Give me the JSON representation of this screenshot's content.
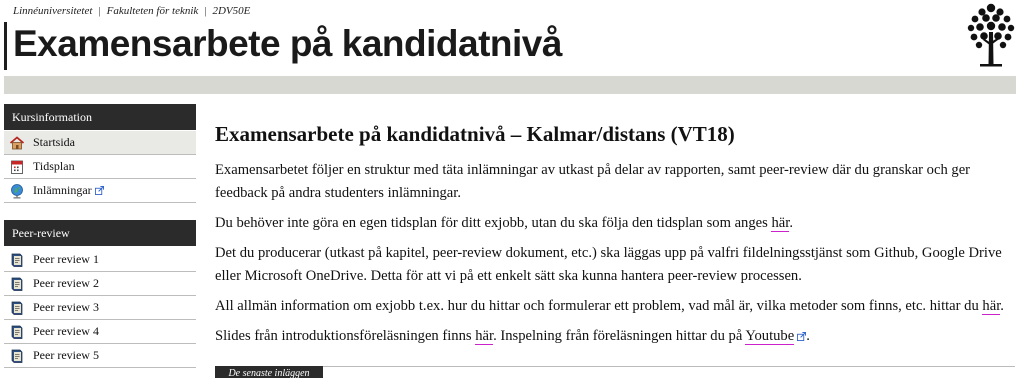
{
  "header": {
    "breadcrumb": [
      "Linnéuniversitetet",
      "Fakulteten för teknik",
      "2DV50E"
    ],
    "breadcrumb_separator": "|",
    "site_title": "Examensarbete på kandidatnivå"
  },
  "sidebar": {
    "sections": [
      {
        "title": "Kursinformation",
        "items": [
          {
            "label": "Startsida",
            "icon": "house-icon",
            "active": true,
            "external": false
          },
          {
            "label": "Tidsplan",
            "icon": "calendar-icon",
            "active": false,
            "external": false
          },
          {
            "label": "Inlämningar",
            "icon": "globe-icon",
            "active": false,
            "external": true
          }
        ]
      },
      {
        "title": "Peer-review",
        "items": [
          {
            "label": "Peer review 1",
            "icon": "book-icon"
          },
          {
            "label": "Peer review 2",
            "icon": "book-icon"
          },
          {
            "label": "Peer review 3",
            "icon": "book-icon"
          },
          {
            "label": "Peer review 4",
            "icon": "book-icon"
          },
          {
            "label": "Peer review 5",
            "icon": "book-icon"
          }
        ]
      }
    ]
  },
  "main": {
    "heading": "Examensarbete på kandidatnivå – Kalmar/distans (VT18)",
    "p1": "Examensarbetet följer en struktur med täta inlämningar av utkast på delar av rapporten, samt peer-review där du granskar och ger feedback på andra studenters inlämningar.",
    "p2_before": "Du behöver inte göra en egen tidsplan för ditt exjobb, utan du ska följa den tidsplan som anges ",
    "p2_link": "här",
    "p2_after": ".",
    "p3": "Det du producerar (utkast på kapitel, peer-review dokument, etc.) ska läggas upp på valfri fildelningsstjänst som Github, Google Drive eller Microsoft OneDrive. Detta för att vi på ett enkelt sätt ska kunna hantera peer-review processen.",
    "p4_before": "All allmän information om exjobb t.ex. hur du hittar och formulerar ett problem, vad mål är, vilka metoder som finns, etc. hittar du ",
    "p4_link": "här",
    "p4_after": ".",
    "p5_before": "Slides från introduktionsföreläsningen finns ",
    "p5_link1": "här",
    "p5_mid": ". Inspelning från föreläsningen hittar du på ",
    "p5_link2": "Youtube",
    "p5_after": ".",
    "latest_tab": "De senaste inläggen"
  },
  "colors": {
    "dark_bar": "#2b2b2b",
    "grey_band": "#d8d8d3",
    "link_underline": "#cc22cc"
  }
}
